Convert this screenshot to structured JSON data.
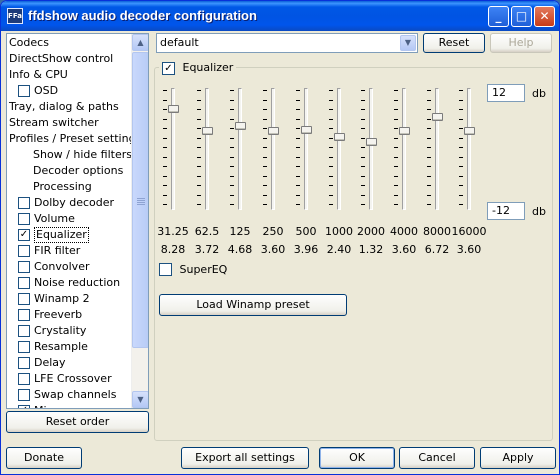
{
  "window": {
    "title": "ffdshow audio decoder configuration",
    "icon_text": "FFa"
  },
  "titlebar_buttons": {
    "minimize": "_",
    "maximize": "□",
    "close": "✕"
  },
  "sidebar": {
    "items": [
      {
        "label": "Codecs",
        "indent": 0,
        "checkbox": null
      },
      {
        "label": "DirectShow control",
        "indent": 0,
        "checkbox": null
      },
      {
        "label": "Info & CPU",
        "indent": 0,
        "checkbox": null
      },
      {
        "label": "OSD",
        "indent": 1,
        "checkbox": false
      },
      {
        "label": "Tray, dialog & paths",
        "indent": 0,
        "checkbox": null
      },
      {
        "label": "Stream switcher",
        "indent": 0,
        "checkbox": null
      },
      {
        "label": "Profiles / Preset settings",
        "indent": 0,
        "checkbox": null
      },
      {
        "label": "Show / hide filters",
        "indent": 2,
        "checkbox": null
      },
      {
        "label": "Decoder options",
        "indent": 2,
        "checkbox": null
      },
      {
        "label": "Processing",
        "indent": 2,
        "checkbox": null
      },
      {
        "label": "Dolby decoder",
        "indent": 1,
        "checkbox": false
      },
      {
        "label": "Volume",
        "indent": 1,
        "checkbox": false
      },
      {
        "label": "Equalizer",
        "indent": 1,
        "checkbox": true,
        "selected": true
      },
      {
        "label": "FIR filter",
        "indent": 1,
        "checkbox": false
      },
      {
        "label": "Convolver",
        "indent": 1,
        "checkbox": false
      },
      {
        "label": "Noise reduction",
        "indent": 1,
        "checkbox": false
      },
      {
        "label": "Winamp 2",
        "indent": 1,
        "checkbox": false
      },
      {
        "label": "Freeverb",
        "indent": 1,
        "checkbox": false
      },
      {
        "label": "Crystality",
        "indent": 1,
        "checkbox": false
      },
      {
        "label": "Resample",
        "indent": 1,
        "checkbox": false
      },
      {
        "label": "Delay",
        "indent": 1,
        "checkbox": false
      },
      {
        "label": "LFE Crossover",
        "indent": 1,
        "checkbox": false
      },
      {
        "label": "Swap channels",
        "indent": 1,
        "checkbox": false
      },
      {
        "label": "Mixer",
        "indent": 1,
        "checkbox": true
      }
    ],
    "reset_order_label": "Reset order"
  },
  "preset": {
    "value": "default",
    "reset_label": "Reset",
    "help_label": "Help"
  },
  "equalizer": {
    "enabled_label": "Equalizer",
    "enabled": true,
    "max_db": "12",
    "min_db": "-12",
    "db_unit": "db",
    "bands": [
      {
        "freq": "31.25",
        "gain": "8.28"
      },
      {
        "freq": "62.5",
        "gain": "3.72"
      },
      {
        "freq": "125",
        "gain": "4.68"
      },
      {
        "freq": "250",
        "gain": "3.60"
      },
      {
        "freq": "500",
        "gain": "3.96"
      },
      {
        "freq": "1000",
        "gain": "2.40"
      },
      {
        "freq": "2000",
        "gain": "1.32"
      },
      {
        "freq": "4000",
        "gain": "3.60"
      },
      {
        "freq": "8000",
        "gain": "6.72"
      },
      {
        "freq": "16000",
        "gain": "3.60"
      }
    ],
    "supereq_label": "SuperEQ",
    "supereq": false,
    "load_winamp_label": "Load Winamp preset"
  },
  "footer": {
    "donate_label": "Donate",
    "export_label": "Export all settings",
    "ok_label": "OK",
    "cancel_label": "Cancel",
    "apply_label": "Apply"
  }
}
